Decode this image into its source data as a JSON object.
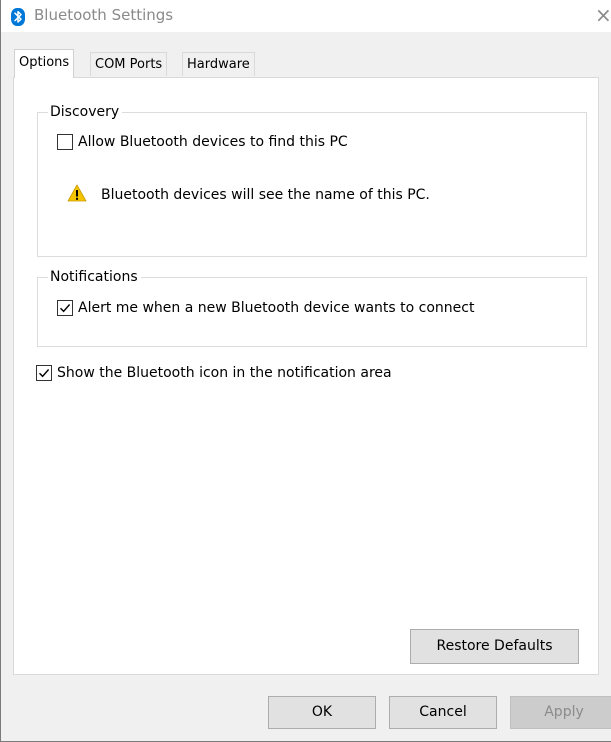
{
  "window": {
    "title": "Bluetooth Settings",
    "close_glyph": "×"
  },
  "tabs": [
    {
      "label": "Options",
      "active": true
    },
    {
      "label": "COM Ports",
      "active": false
    },
    {
      "label": "Hardware",
      "active": false
    }
  ],
  "discovery": {
    "legend": "Discovery",
    "allow_label": "Allow Bluetooth devices to find this PC",
    "allow_checked": false,
    "warning_text": "Bluetooth devices will see the name of this PC.",
    "warning_icon": "warning-triangle-icon"
  },
  "notifications": {
    "legend": "Notifications",
    "alert_label": "Alert me when a new Bluetooth device wants to connect",
    "alert_checked": true
  },
  "show_icon": {
    "label": "Show the Bluetooth icon in the notification area",
    "checked": true
  },
  "buttons": {
    "restore_defaults": "Restore Defaults",
    "ok": "OK",
    "cancel": "Cancel",
    "apply": "Apply",
    "apply_disabled": true
  },
  "colors": {
    "bluetooth_blue": "#0078d7",
    "warning_yellow": "#f4c400"
  }
}
